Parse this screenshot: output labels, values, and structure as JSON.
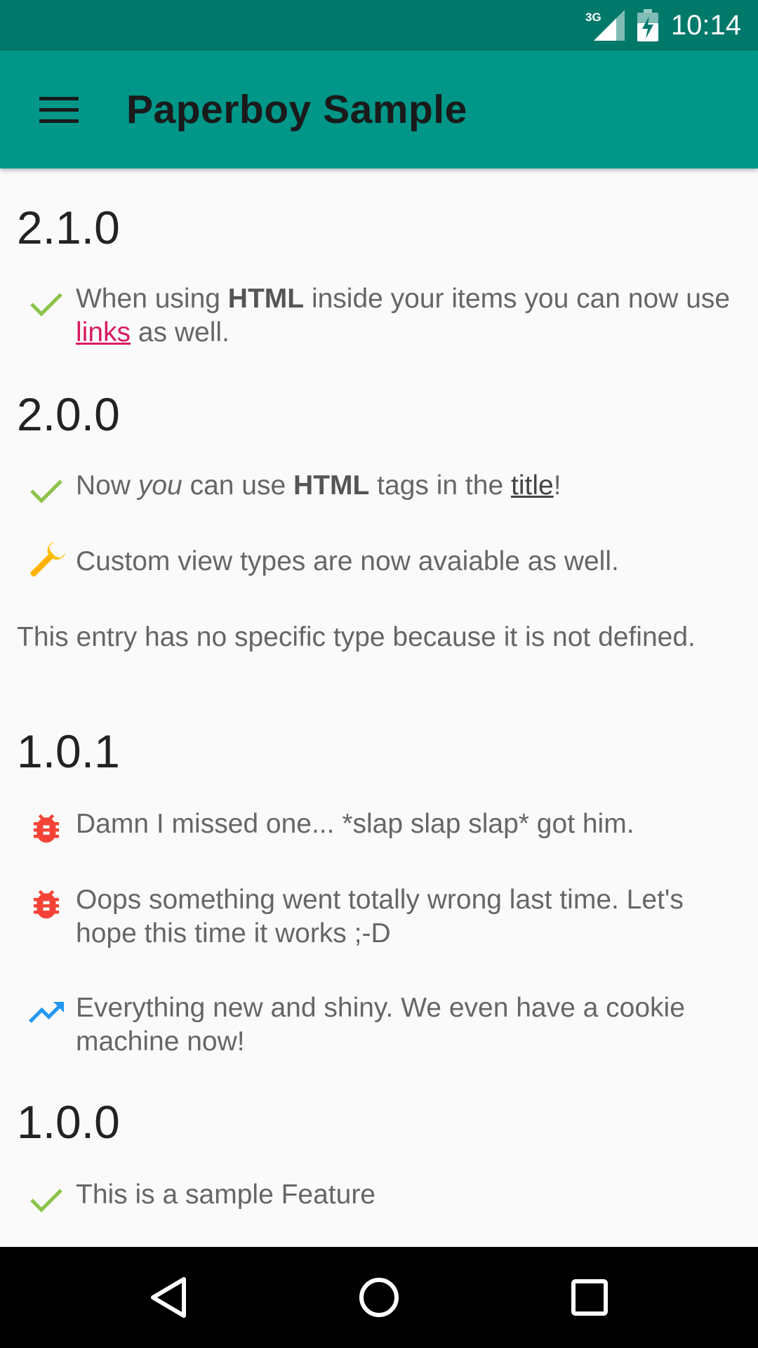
{
  "status_bar": {
    "network": "3G",
    "time": "10:14"
  },
  "toolbar": {
    "title": "Paperboy Sample"
  },
  "versions": [
    {
      "title": "2.1.0"
    },
    {
      "title": "2.0.0"
    },
    {
      "title": "1.0.1"
    },
    {
      "title": "1.0.0"
    }
  ],
  "items": {
    "i210_1": {
      "type": "feature",
      "p1": "When using ",
      "b1": "HTML",
      "p2": " inside your items you can now use ",
      "link": "links",
      "p3": " as well."
    },
    "i200_1": {
      "type": "feature",
      "p1": "Now ",
      "em": "you",
      "p2": " can use ",
      "b1": "HTML",
      "p3": " tags in the ",
      "u": "title",
      "p4": "!"
    },
    "i200_2": {
      "type": "custom",
      "text": "Custom view types are now avaiable as well."
    },
    "i200_3": {
      "type": "none",
      "text": "This entry has no specific type because it is not defined."
    },
    "i101_1": {
      "type": "bug",
      "text": "Damn I missed one... *slap slap slap* got him."
    },
    "i101_2": {
      "type": "bug",
      "text": "Oops something went totally wrong last time. Let's hope this time it works ;-D"
    },
    "i101_3": {
      "type": "improvement",
      "text": "Everything new and shiny. We even have a cookie machine now!"
    },
    "i100_1": {
      "type": "feature",
      "text": "This is a sample Feature"
    }
  },
  "icons": {
    "feature": "check-icon",
    "custom": "wrench-icon",
    "bug": "bug-icon",
    "improvement": "trending-up-icon"
  },
  "colors": {
    "status_bar": "#00796b",
    "toolbar": "#009688",
    "check": "#8bc34a",
    "bug": "#f44336",
    "improvement": "#2196f3",
    "wrench": "#ffc107",
    "link": "#d81b60"
  },
  "nav": {
    "back": "back-icon",
    "home": "home-icon",
    "recents": "recents-icon"
  }
}
